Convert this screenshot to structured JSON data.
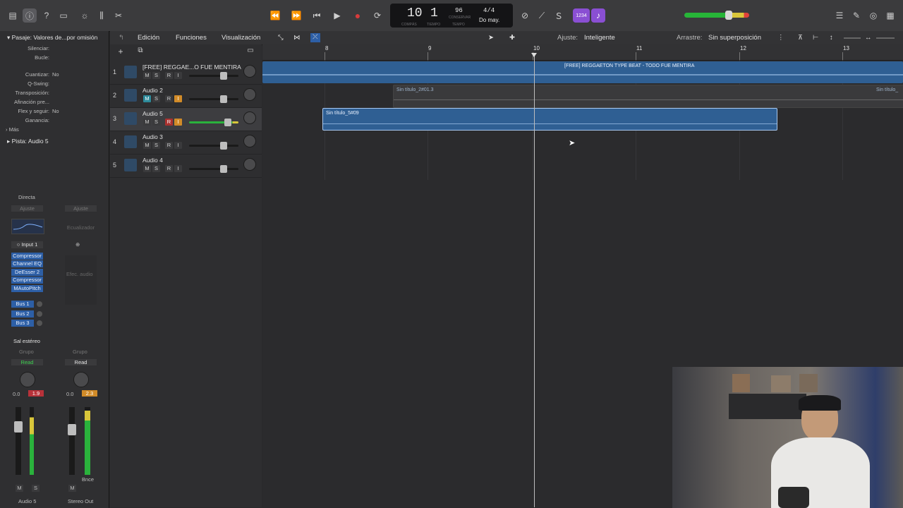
{
  "toolbar": {
    "transport": {
      "rewind": "⏪",
      "forward": "⏩",
      "to_start": "⏮",
      "play": "▶",
      "record": "●",
      "cycle": "⟳"
    },
    "lcd": {
      "bar": "10",
      "beat": "1",
      "tempo": "96",
      "tempo_mode": "CONSERVAR",
      "signature": "4/4",
      "key": "Do may.",
      "cap_bar": "COMPÁS",
      "cap_beat": "TIEMPO",
      "cap_tempo": "TEMPO"
    },
    "count_in": "1234",
    "colors": {
      "record": "#d63b3b",
      "lcd_bg": "#141416",
      "purple": "#8a4fd3",
      "region_blue": "#2f5f93"
    }
  },
  "menubar": {
    "edit": "Edición",
    "functions": "Funciones",
    "view": "Visualización",
    "snap_label": "Ajuste:",
    "snap_value": "Inteligente",
    "drag_label": "Arrastre:",
    "drag_value": "Sin superposición"
  },
  "inspector": {
    "region_header": "Pasaje: Valores de...por omisión",
    "rows": [
      {
        "label": "Silenciar:",
        "value": ""
      },
      {
        "label": "Bucle:",
        "value": ""
      },
      {
        "label": "Cuantizar:",
        "value": "No"
      },
      {
        "label": "Q-Swing:",
        "value": ""
      },
      {
        "label": "Transposición:",
        "value": ""
      },
      {
        "label": "Afinación pre...",
        "value": ""
      },
      {
        "label": "Flex y seguir:",
        "value": "No"
      },
      {
        "label": "Ganancia:",
        "value": ""
      }
    ],
    "more": "Más",
    "track_header": "Pista:",
    "track_value": "Audio 5",
    "strip1": {
      "direct": "Directa",
      "setting": "Ajuste",
      "input": "Input 1",
      "plugins": [
        "Compressor",
        "Channel EQ",
        "DeEsser 2",
        "Compressor",
        "MAutoPitch"
      ],
      "sends": [
        "Bus 1",
        "Bus 2",
        "Bus 3"
      ],
      "output": "Sal estéreo",
      "group": "Grupo",
      "automation": "Read",
      "pan_value": "0.0",
      "peak": "1.9",
      "mute": "M",
      "solo": "S",
      "name": "Audio 5"
    },
    "strip2": {
      "setting": "Ajuste",
      "eq": "Ecualizador",
      "fx": "Efec. audio",
      "group": "Grupo",
      "automation": "Read",
      "pan_value": "0.0",
      "peak": "2.3",
      "mute": "M",
      "bounce": "Bnce",
      "name": "Stereo Out"
    }
  },
  "tracks": [
    {
      "num": "1",
      "name": "[FREE] REGGAE...O FUE MENTIRA",
      "m": "M",
      "s": "S",
      "r": "R",
      "i": "I"
    },
    {
      "num": "2",
      "name": "Audio 2",
      "m": "M",
      "s": "S",
      "r": "R",
      "i": "I"
    },
    {
      "num": "3",
      "name": "Audio 5",
      "m": "M",
      "s": "S",
      "r": "R",
      "i": "I"
    },
    {
      "num": "4",
      "name": "Audio 3",
      "m": "M",
      "s": "S",
      "r": "R",
      "i": "I"
    },
    {
      "num": "5",
      "name": "Audio 4",
      "m": "M",
      "s": "S",
      "r": "R",
      "i": "I"
    }
  ],
  "ruler": {
    "bars": [
      "8",
      "9",
      "10",
      "11",
      "12",
      "13"
    ]
  },
  "regions": {
    "beat": "[FREE] REGGAETON TYPE BEAT - TODO FUE MENTIRA",
    "take2a": "Sin título_2#01.3",
    "take2b": "Sin título_",
    "take5": "Sin título_5#09"
  }
}
